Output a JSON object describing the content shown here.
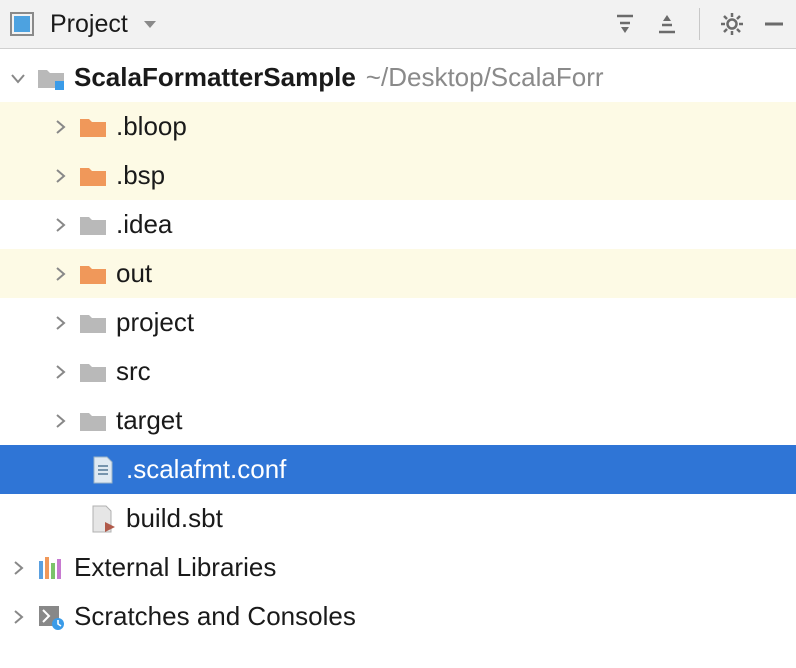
{
  "toolbar": {
    "title": "Project"
  },
  "tree": {
    "root": {
      "name": "ScalaFormatterSample",
      "path": "~/Desktop/ScalaForr"
    },
    "children": [
      {
        "name": ".bloop",
        "type": "folder-orange"
      },
      {
        "name": ".bsp",
        "type": "folder-orange"
      },
      {
        "name": ".idea",
        "type": "folder-gray"
      },
      {
        "name": "out",
        "type": "folder-orange"
      },
      {
        "name": "project",
        "type": "folder-gray"
      },
      {
        "name": "src",
        "type": "folder-gray"
      },
      {
        "name": "target",
        "type": "folder-gray"
      },
      {
        "name": ".scalafmt.conf",
        "type": "file-conf"
      },
      {
        "name": "build.sbt",
        "type": "file-sbt"
      }
    ],
    "external": "External Libraries",
    "scratches": "Scratches and Consoles"
  }
}
